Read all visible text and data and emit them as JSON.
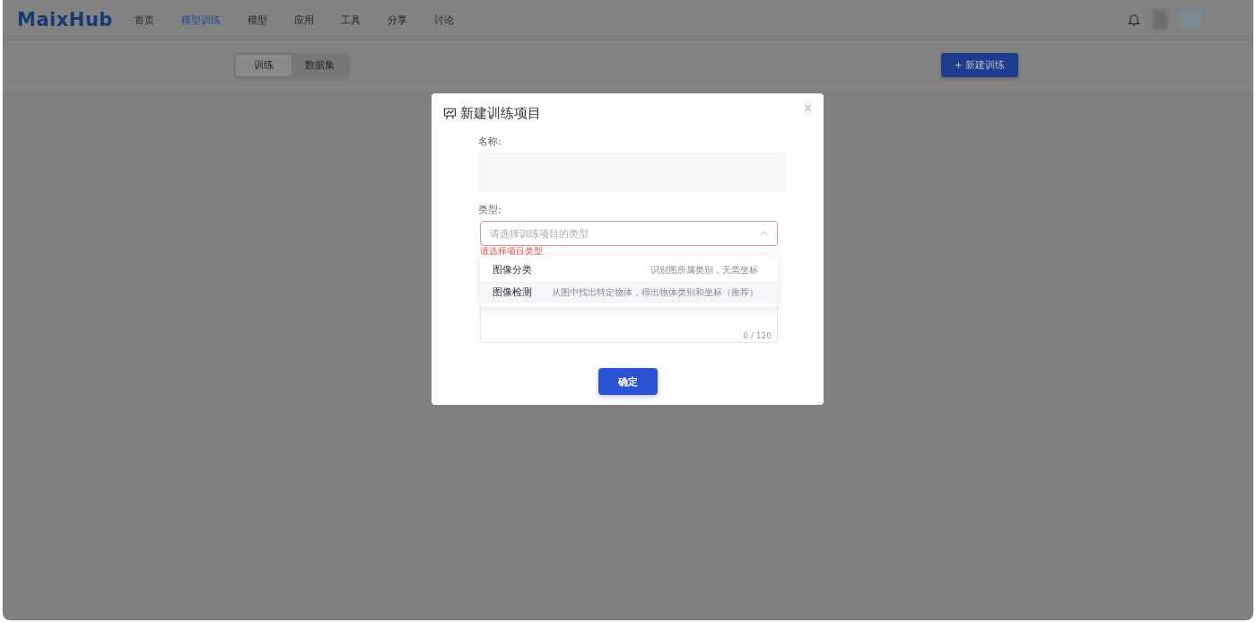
{
  "header": {
    "logo": "MaixHub",
    "nav": [
      {
        "label": "首页",
        "selected": false
      },
      {
        "label": "模型训练",
        "selected": true
      },
      {
        "label": "模型",
        "selected": false
      },
      {
        "label": "应用",
        "selected": false
      },
      {
        "label": "工具",
        "selected": false
      },
      {
        "label": "分享",
        "selected": false
      },
      {
        "label": "讨论",
        "selected": false
      }
    ]
  },
  "subbar": {
    "tabs": [
      {
        "label": "训练",
        "selected": true
      },
      {
        "label": "数据集",
        "selected": false
      }
    ],
    "new_button": "+ 新建训练"
  },
  "dialog": {
    "title": "新建训练项目",
    "name_label": "名称:",
    "type_label": "类型:",
    "type_select": {
      "placeholder": "请选择训练项目的类型",
      "expanded": true,
      "error": "请选择项目类型",
      "options": [
        {
          "label": "图像分类",
          "description": "识别图所属类别，无需坐标",
          "selected": false
        },
        {
          "label": "图像检测",
          "description": "从图中找出特定物体，得出物体类别和坐标（推荐）",
          "selected": true
        }
      ]
    },
    "description_counter": "0 / 120",
    "confirm_button": "确定"
  }
}
